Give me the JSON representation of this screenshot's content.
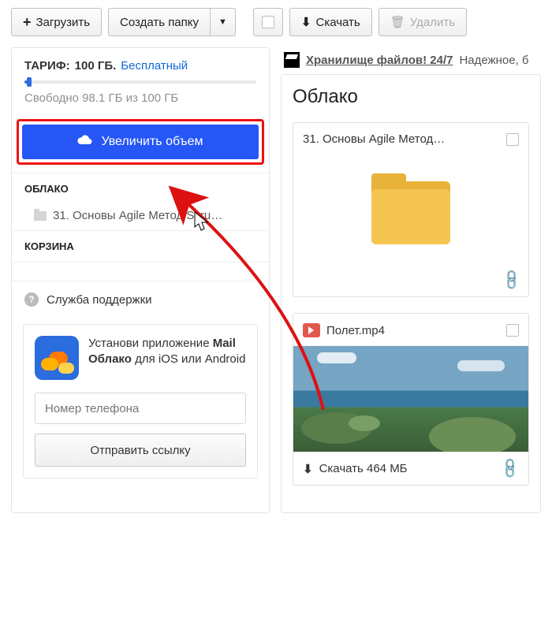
{
  "toolbar": {
    "upload": "Загрузить",
    "create_folder": "Создать папку",
    "download": "Скачать",
    "delete": "Удалить"
  },
  "sidebar": {
    "tariff_label": "ТАРИФ:",
    "tariff_value": "100 ГБ.",
    "tariff_link": "Бесплатный",
    "free_text": "Свободно 98.1 ГБ из 100 ГБ",
    "upgrade": "Увеличить объем",
    "cloud_hdr": "ОБЛАКО",
    "tree_item": "31. Основы Agile Метод Scru…",
    "trash_hdr": "КОРЗИНА",
    "support": "Служба поддержки",
    "promo_pre": "Установи приложение ",
    "promo_bold": "Mail Облако",
    "promo_post": " для iOS или Android",
    "phone_placeholder": "Номер телефона",
    "send_link": "Отправить ссылку"
  },
  "banner": {
    "link": "Хранилище файлов! 24/7",
    "tail": " Надежное, б"
  },
  "main": {
    "title": "Облако",
    "folder_name": "31. Основы Agile Метод…",
    "video_name": "Полет.mp4",
    "download_label": "Скачать 464 МБ"
  }
}
